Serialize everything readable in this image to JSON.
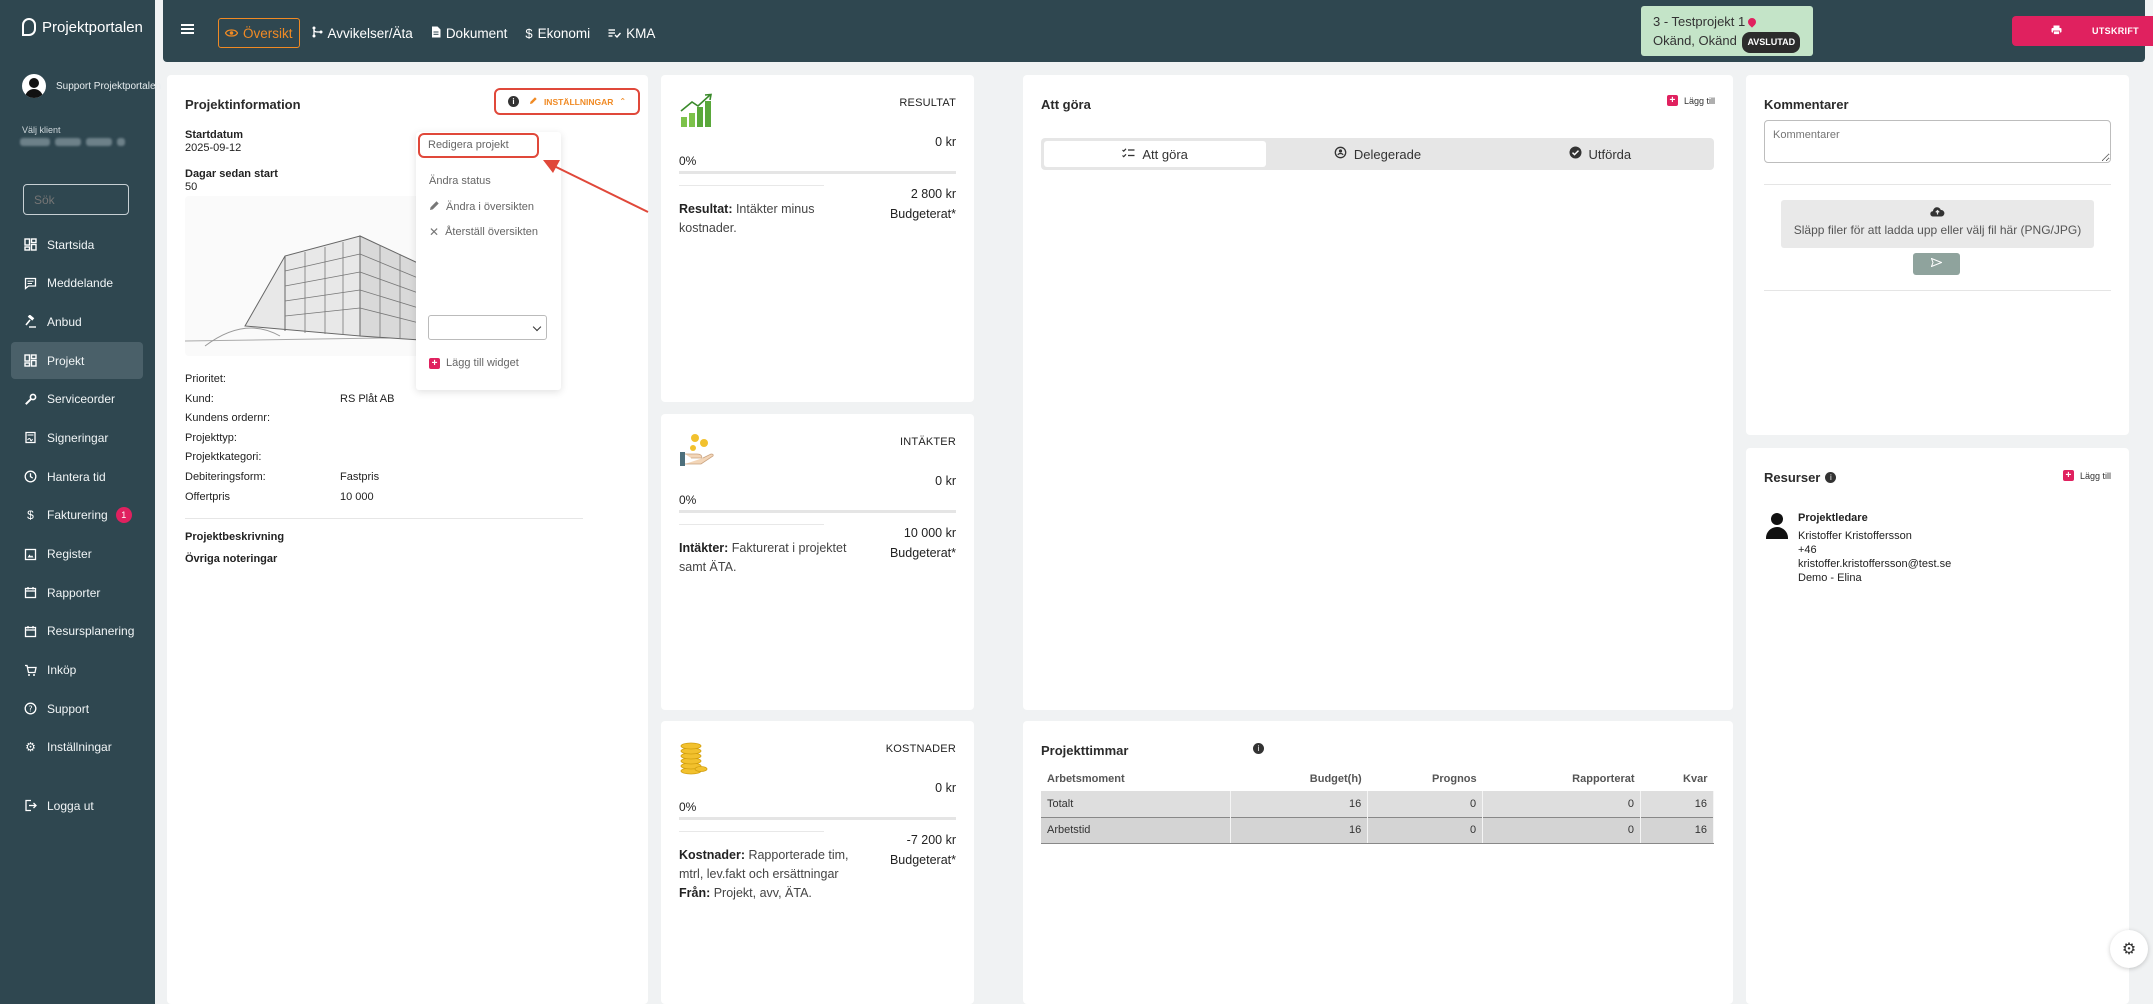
{
  "app": {
    "name": "Projektportalen"
  },
  "user": {
    "name": "Support Projektportalen"
  },
  "client": {
    "label": "Välj klient"
  },
  "sidebar": {
    "search_placeholder": "Sök",
    "items": [
      {
        "label": "Startsida",
        "icon": "grid-icon"
      },
      {
        "label": "Meddelande",
        "icon": "message-icon"
      },
      {
        "label": "Anbud",
        "icon": "gavel-icon"
      },
      {
        "label": "Projekt",
        "icon": "dashboard-icon"
      },
      {
        "label": "Serviceorder",
        "icon": "wrench-icon"
      },
      {
        "label": "Signeringar",
        "icon": "signature-icon"
      },
      {
        "label": "Hantera tid",
        "icon": "clock-icon"
      },
      {
        "label": "Fakturering",
        "icon": "dollar-icon",
        "badge": "1"
      },
      {
        "label": "Register",
        "icon": "register-icon"
      },
      {
        "label": "Rapporter",
        "icon": "calendar-icon"
      },
      {
        "label": "Resursplanering",
        "icon": "calendar-icon"
      },
      {
        "label": "Inköp",
        "icon": "cart-icon"
      },
      {
        "label": "Support",
        "icon": "help-icon"
      },
      {
        "label": "Inställningar",
        "icon": "gear-icon"
      }
    ],
    "logout": "Logga ut"
  },
  "topbar": {
    "tabs": [
      {
        "label": "Översikt",
        "icon": "eye-icon",
        "active": true
      },
      {
        "label": "Avvikelser/Äta",
        "icon": "branch-icon"
      },
      {
        "label": "Dokument",
        "icon": "document-icon"
      },
      {
        "label": "Ekonomi",
        "icon": "dollar-icon"
      },
      {
        "label": "KMA",
        "icon": "list-check-icon"
      }
    ],
    "project": {
      "title": "3 - Testprojekt 1",
      "location": "Okänd, Okänd",
      "status": "AVSLUTAD"
    },
    "print": "UTSKRIFT"
  },
  "projectinfo": {
    "title": "Projektinformation",
    "settings": "INSTÄLLNINGAR",
    "start_label": "Startdatum",
    "start_value": "2025-09-12",
    "days_label": "Dagar sedan start",
    "days_value": "50",
    "menu": {
      "edit": "Redigera projekt",
      "change_status": "Ändra status",
      "change_overview": "Ändra i översikten",
      "reset_overview": "Återställ översikten",
      "add_widget": "Lägg till widget"
    },
    "props": [
      {
        "label": "Prioritet:",
        "value": ""
      },
      {
        "label": "Kund:",
        "value": "RS Plåt AB"
      },
      {
        "label": "Kundens ordernr:",
        "value": ""
      },
      {
        "label": "Projekttyp:",
        "value": ""
      },
      {
        "label": "Projektkategori:",
        "value": ""
      },
      {
        "label": "Debiteringsform:",
        "value": "Fastpris"
      },
      {
        "label": "Offertpris",
        "value": "10 000"
      }
    ],
    "description_label": "Projektbeskrivning",
    "notes_label": "Övriga noteringar"
  },
  "kpi": {
    "result": {
      "label": "RESULTAT",
      "amount": "0 kr",
      "pct": "0%",
      "progress": 0,
      "budget": "2 800 kr",
      "budget_label": "Budgeterat*",
      "desc_bold": "Resultat:",
      "desc": " Intäkter minus kostnader."
    },
    "income": {
      "label": "INTÄKTER",
      "amount": "0 kr",
      "pct": "0%",
      "progress": 0,
      "budget": "10 000 kr",
      "budget_label": "Budgeterat*",
      "desc_bold": "Intäkter:",
      "desc": " Fakturerat i projektet samt ÄTA."
    },
    "costs": {
      "label": "KOSTNADER",
      "amount": "0 kr",
      "pct": "0%",
      "progress": 0,
      "budget": "-7 200 kr",
      "budget_label": "Budgeterat*",
      "desc_bold": "Kostnader:",
      "desc": " Rapporterade tim, mtrl, lev.fakt och ersättningar",
      "from_bold": "Från:",
      "from": " Projekt, avv, ÄTA."
    }
  },
  "todo": {
    "title": "Att göra",
    "add": "Lägg till",
    "segments": [
      "Att göra",
      "Delegerade",
      "Utförda"
    ]
  },
  "hours": {
    "title": "Projekttimmar",
    "columns": [
      "Arbetsmoment",
      "Budget(h)",
      "Prognos",
      "Rapporterat",
      "Kvar"
    ],
    "rows": [
      [
        "Totalt",
        "16",
        "0",
        "0",
        "16"
      ],
      [
        "Arbetstid",
        "16",
        "0",
        "0",
        "16"
      ]
    ]
  },
  "comments": {
    "title": "Kommentarer",
    "placeholder": "Kommentarer",
    "dropzone": "Släpp filer för att ladda upp eller välj fil här (PNG/JPG)"
  },
  "resources": {
    "title": "Resurser",
    "add": "Lägg till",
    "role": "Projektledare",
    "name": "Kristoffer Kristoffersson",
    "phone": "+46",
    "email": "kristoffer.kristoffersson@test.se",
    "company": "Demo - Elina"
  },
  "colors": {
    "sidebar": "#2f4750",
    "accent_orange": "#f08a24",
    "accent_pink": "#e0215f",
    "status_green": "#c4e4c8",
    "highlight_red": "#e0483a"
  }
}
